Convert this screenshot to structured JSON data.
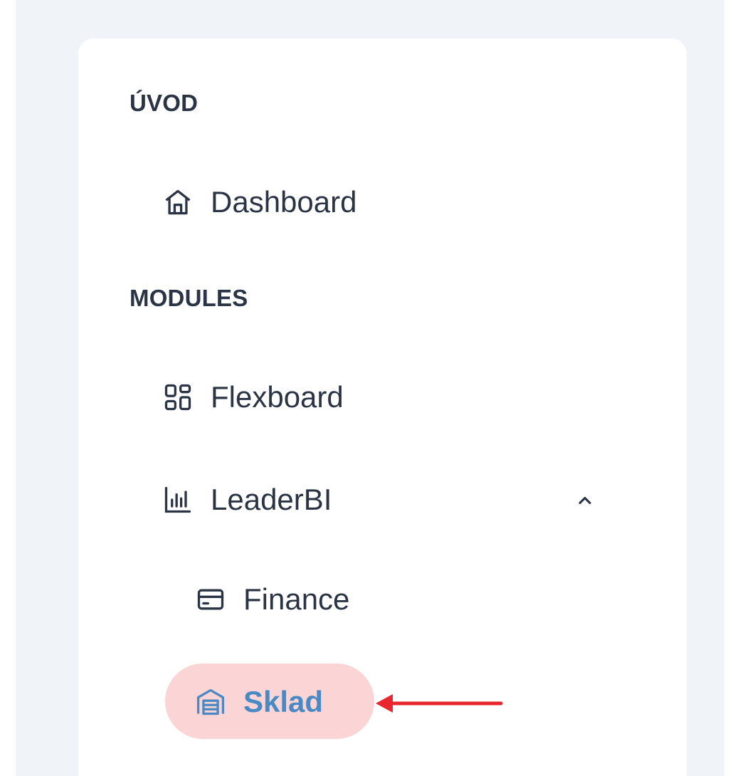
{
  "sections": {
    "intro": {
      "title": "ÚVOD"
    },
    "modules": {
      "title": "MODULES"
    }
  },
  "nav": {
    "dashboard": {
      "label": "Dashboard",
      "icon": "home-icon"
    },
    "flexboard": {
      "label": "Flexboard",
      "icon": "grid-layout-icon"
    },
    "leaderbi": {
      "label": "LeaderBI",
      "icon": "bar-chart-icon",
      "expanded": true
    },
    "finance": {
      "label": "Finance",
      "icon": "credit-card-icon"
    },
    "sklad": {
      "label": "Sklad",
      "icon": "warehouse-icon",
      "active": true
    }
  },
  "colors": {
    "page_background": "#f0f3f8",
    "text": "#2b3445",
    "active_text": "#4a8ac4",
    "active_background": "#fbd5d5",
    "annotation_arrow": "#e8262d"
  }
}
